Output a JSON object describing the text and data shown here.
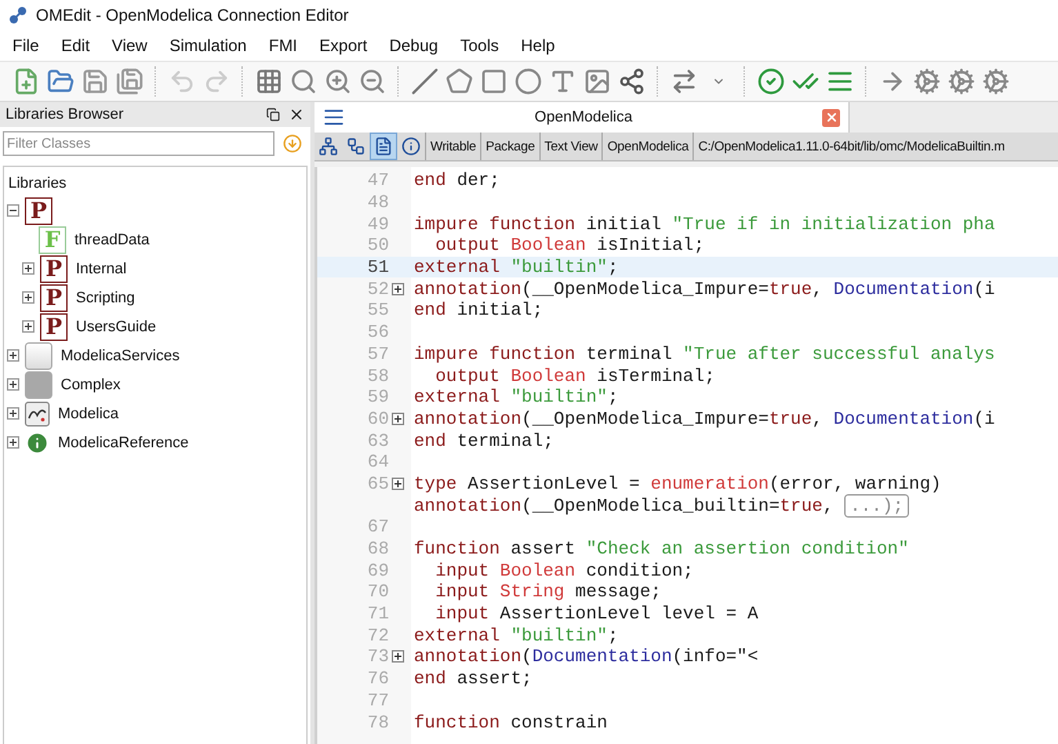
{
  "window": {
    "title": "OMEdit - OpenModelica Connection Editor"
  },
  "menu": [
    "File",
    "Edit",
    "View",
    "Simulation",
    "FMI",
    "Export",
    "Debug",
    "Tools",
    "Help"
  ],
  "libraries_browser": {
    "title": "Libraries Browser",
    "filter": {
      "placeholder": "Filter Classes"
    },
    "heading": "Libraries",
    "tree": [
      {
        "icon": {
          "kind": "package",
          "letter": "P"
        },
        "expanded": true,
        "children": [
          {
            "label": "threadData",
            "icon": {
              "kind": "function",
              "letter": "F"
            }
          },
          {
            "label": "Internal",
            "icon": {
              "kind": "package",
              "letter": "P"
            },
            "expanded": false
          },
          {
            "label": "Scripting",
            "icon": {
              "kind": "package",
              "letter": "P"
            },
            "expanded": false
          },
          {
            "label": "UsersGuide",
            "icon": {
              "kind": "package",
              "letter": "P"
            },
            "expanded": false
          }
        ]
      },
      {
        "label": "ModelicaServices",
        "icon": {
          "kind": "blank"
        },
        "expanded": false
      },
      {
        "label": "Complex",
        "icon": {
          "kind": "record"
        },
        "expanded": false
      },
      {
        "label": "Modelica",
        "icon": {
          "kind": "library"
        },
        "expanded": false
      },
      {
        "label": "ModelicaReference",
        "icon": {
          "kind": "info"
        },
        "expanded": false
      }
    ]
  },
  "editor": {
    "tab": {
      "title": "OpenModelica"
    },
    "view_buttons": [
      {
        "kind": "diagram",
        "selected": false
      },
      {
        "kind": "icon",
        "selected": false
      },
      {
        "kind": "text",
        "selected": true
      },
      {
        "kind": "info",
        "selected": false
      }
    ],
    "info_fields": [
      "Writable",
      "Package",
      "Text View",
      "OpenModelica",
      "C:/OpenModelica1.11.0-64bit/lib/omc/ModelicaBuiltin.m"
    ],
    "lines": [
      {
        "number": "47",
        "folded": false,
        "current": false,
        "tokens": [
          {
            "kind": "keyword",
            "text": "end"
          },
          {
            "kind": "plain",
            "text": " der;"
          }
        ]
      },
      {
        "number": "48",
        "folded": false,
        "current": false
      },
      {
        "number": "49",
        "folded": false,
        "current": false,
        "tokens": [
          {
            "kind": "keyword",
            "text": "impure function"
          },
          {
            "kind": "plain",
            "text": " initial "
          },
          {
            "kind": "string",
            "text": "\"True if in initialization pha"
          }
        ]
      },
      {
        "number": "50",
        "folded": false,
        "current": false,
        "tokens": [
          {
            "kind": "keyword",
            "text": "  output"
          },
          {
            "kind": "type",
            "text": " Boolean"
          },
          {
            "kind": "plain",
            "text": " isInitial;"
          }
        ]
      },
      {
        "number": "51",
        "folded": false,
        "current": true,
        "tokens": [
          {
            "kind": "keyword",
            "text": "external"
          },
          {
            "kind": "string",
            "text": " \"builtin\""
          },
          {
            "kind": "plain",
            "text": ";"
          }
        ]
      },
      {
        "number": "52",
        "folded": true,
        "current": false,
        "tokens": [
          {
            "kind": "keyword",
            "text": "annotation"
          },
          {
            "kind": "plain",
            "text": "(__OpenModelica_Impure="
          },
          {
            "kind": "keyword",
            "text": "true"
          },
          {
            "kind": "plain",
            "text": ", "
          },
          {
            "kind": "call",
            "text": "Documentation"
          },
          {
            "kind": "plain",
            "text": "(i"
          }
        ]
      },
      {
        "number": "55",
        "folded": false,
        "current": false,
        "tokens": [
          {
            "kind": "keyword",
            "text": "end"
          },
          {
            "kind": "plain",
            "text": " initial;"
          }
        ]
      },
      {
        "number": "56",
        "folded": false,
        "current": false
      },
      {
        "number": "57",
        "folded": false,
        "current": false,
        "tokens": [
          {
            "kind": "keyword",
            "text": "impure function"
          },
          {
            "kind": "plain",
            "text": " terminal "
          },
          {
            "kind": "string",
            "text": "\"True after successful analys"
          }
        ]
      },
      {
        "number": "58",
        "folded": false,
        "current": false,
        "tokens": [
          {
            "kind": "keyword",
            "text": "  output"
          },
          {
            "kind": "type",
            "text": " Boolean"
          },
          {
            "kind": "plain",
            "text": " isTerminal;"
          }
        ]
      },
      {
        "number": "59",
        "folded": false,
        "current": false,
        "tokens": [
          {
            "kind": "keyword",
            "text": "external"
          },
          {
            "kind": "string",
            "text": " \"builtin\""
          },
          {
            "kind": "plain",
            "text": ";"
          }
        ]
      },
      {
        "number": "60",
        "folded": true,
        "current": false,
        "tokens": [
          {
            "kind": "keyword",
            "text": "annotation"
          },
          {
            "kind": "plain",
            "text": "(__OpenModelica_Impure="
          },
          {
            "kind": "keyword",
            "text": "true"
          },
          {
            "kind": "plain",
            "text": ", "
          },
          {
            "kind": "call",
            "text": "Documentation"
          },
          {
            "kind": "plain",
            "text": "(i"
          }
        ]
      },
      {
        "number": "63",
        "folded": false,
        "current": false,
        "tokens": [
          {
            "kind": "keyword",
            "text": "end"
          },
          {
            "kind": "plain",
            "text": " terminal;"
          }
        ]
      },
      {
        "number": "64",
        "folded": false,
        "current": false
      },
      {
        "number": "65",
        "folded": true,
        "current": false,
        "tokens": [
          {
            "kind": "keyword",
            "text": "type"
          },
          {
            "kind": "plain",
            "text": " AssertionLevel = "
          },
          {
            "kind": "type",
            "text": "enumeration"
          },
          {
            "kind": "plain",
            "text": "(error, warning)"
          }
        ]
      },
      {
        "folded": false,
        "current": false,
        "tokens": [
          {
            "kind": "keyword",
            "text": "annotation"
          },
          {
            "kind": "plain",
            "text": "(__OpenModelica_builtin="
          },
          {
            "kind": "keyword",
            "text": "true"
          },
          {
            "kind": "plain",
            "text": ", "
          },
          {
            "kind": "collapsed",
            "text": "...);"
          }
        ]
      },
      {
        "number": "67",
        "folded": false,
        "current": false
      },
      {
        "number": "68",
        "folded": false,
        "current": false,
        "tokens": [
          {
            "kind": "keyword",
            "text": "function"
          },
          {
            "kind": "plain",
            "text": " assert "
          },
          {
            "kind": "string",
            "text": "\"Check an assertion condition\""
          }
        ]
      },
      {
        "number": "69",
        "folded": false,
        "current": false,
        "tokens": [
          {
            "kind": "keyword",
            "text": "  input"
          },
          {
            "kind": "type",
            "text": " Boolean"
          },
          {
            "kind": "plain",
            "text": " condition;"
          }
        ]
      },
      {
        "number": "70",
        "folded": false,
        "current": false,
        "tokens": [
          {
            "kind": "keyword",
            "text": "  input"
          },
          {
            "kind": "type",
            "text": " String"
          },
          {
            "kind": "plain",
            "text": " message;"
          }
        ]
      },
      {
        "number": "71",
        "folded": false,
        "current": false,
        "tokens": [
          {
            "kind": "keyword",
            "text": "  input"
          },
          {
            "kind": "plain",
            "text": " AssertionLevel level = A"
          }
        ]
      },
      {
        "number": "72",
        "folded": false,
        "current": false,
        "tokens": [
          {
            "kind": "keyword",
            "text": "external"
          },
          {
            "kind": "string",
            "text": " \"builtin\""
          },
          {
            "kind": "plain",
            "text": ";"
          }
        ]
      },
      {
        "number": "73",
        "folded": true,
        "current": false,
        "tokens": [
          {
            "kind": "keyword",
            "text": "annotation"
          },
          {
            "kind": "plain",
            "text": "("
          },
          {
            "kind": "call",
            "text": "Documentation"
          },
          {
            "kind": "plain",
            "text": "(info=\"<"
          }
        ]
      },
      {
        "number": "76",
        "folded": false,
        "current": false,
        "tokens": [
          {
            "kind": "keyword",
            "text": "end"
          },
          {
            "kind": "plain",
            "text": " assert;"
          }
        ]
      },
      {
        "number": "77",
        "folded": false,
        "current": false
      },
      {
        "number": "78",
        "folded": false,
        "current": false,
        "tokens": [
          {
            "kind": "keyword",
            "text": "function"
          },
          {
            "kind": "plain",
            "text": " constrain"
          }
        ]
      }
    ]
  }
}
